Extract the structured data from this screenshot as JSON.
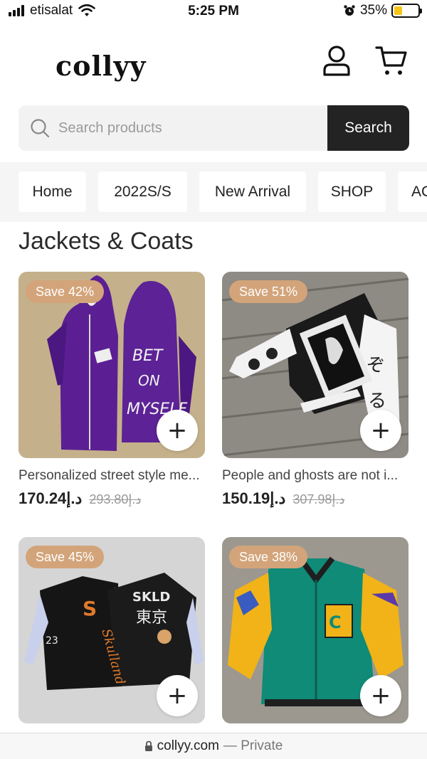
{
  "status": {
    "carrier": "etisalat",
    "time": "5:25 PM",
    "battery": "35%",
    "battery_level": 0.35
  },
  "header": {
    "logo": "collyy",
    "icons": [
      "user-icon",
      "cart-icon"
    ]
  },
  "search": {
    "placeholder": "Search products",
    "button_label": "Search"
  },
  "nav": {
    "items": [
      "Home",
      "2022S/S",
      "New Arrival",
      "SHOP",
      "AC"
    ]
  },
  "section": {
    "title": "Jackets & Coats"
  },
  "products": [
    {
      "badge": "Save 42%",
      "title": "Personalized street style me...",
      "price": "170.24د.إ",
      "was": "293.80د.إ",
      "add_label": "+"
    },
    {
      "badge": "Save 51%",
      "title": "People and ghosts are not i...",
      "price": "150.19د.إ",
      "was": "307.98د.إ",
      "add_label": "+"
    },
    {
      "badge": "Save 45%",
      "add_label": "+"
    },
    {
      "badge": "Save 38%",
      "add_label": "+"
    }
  ],
  "url_bar": {
    "domain": "collyy.com",
    "suffix": "— Private"
  },
  "colors": {
    "badge": "#d3a47a",
    "search_button": "#232323",
    "nav_background": "#f5f5f5"
  }
}
